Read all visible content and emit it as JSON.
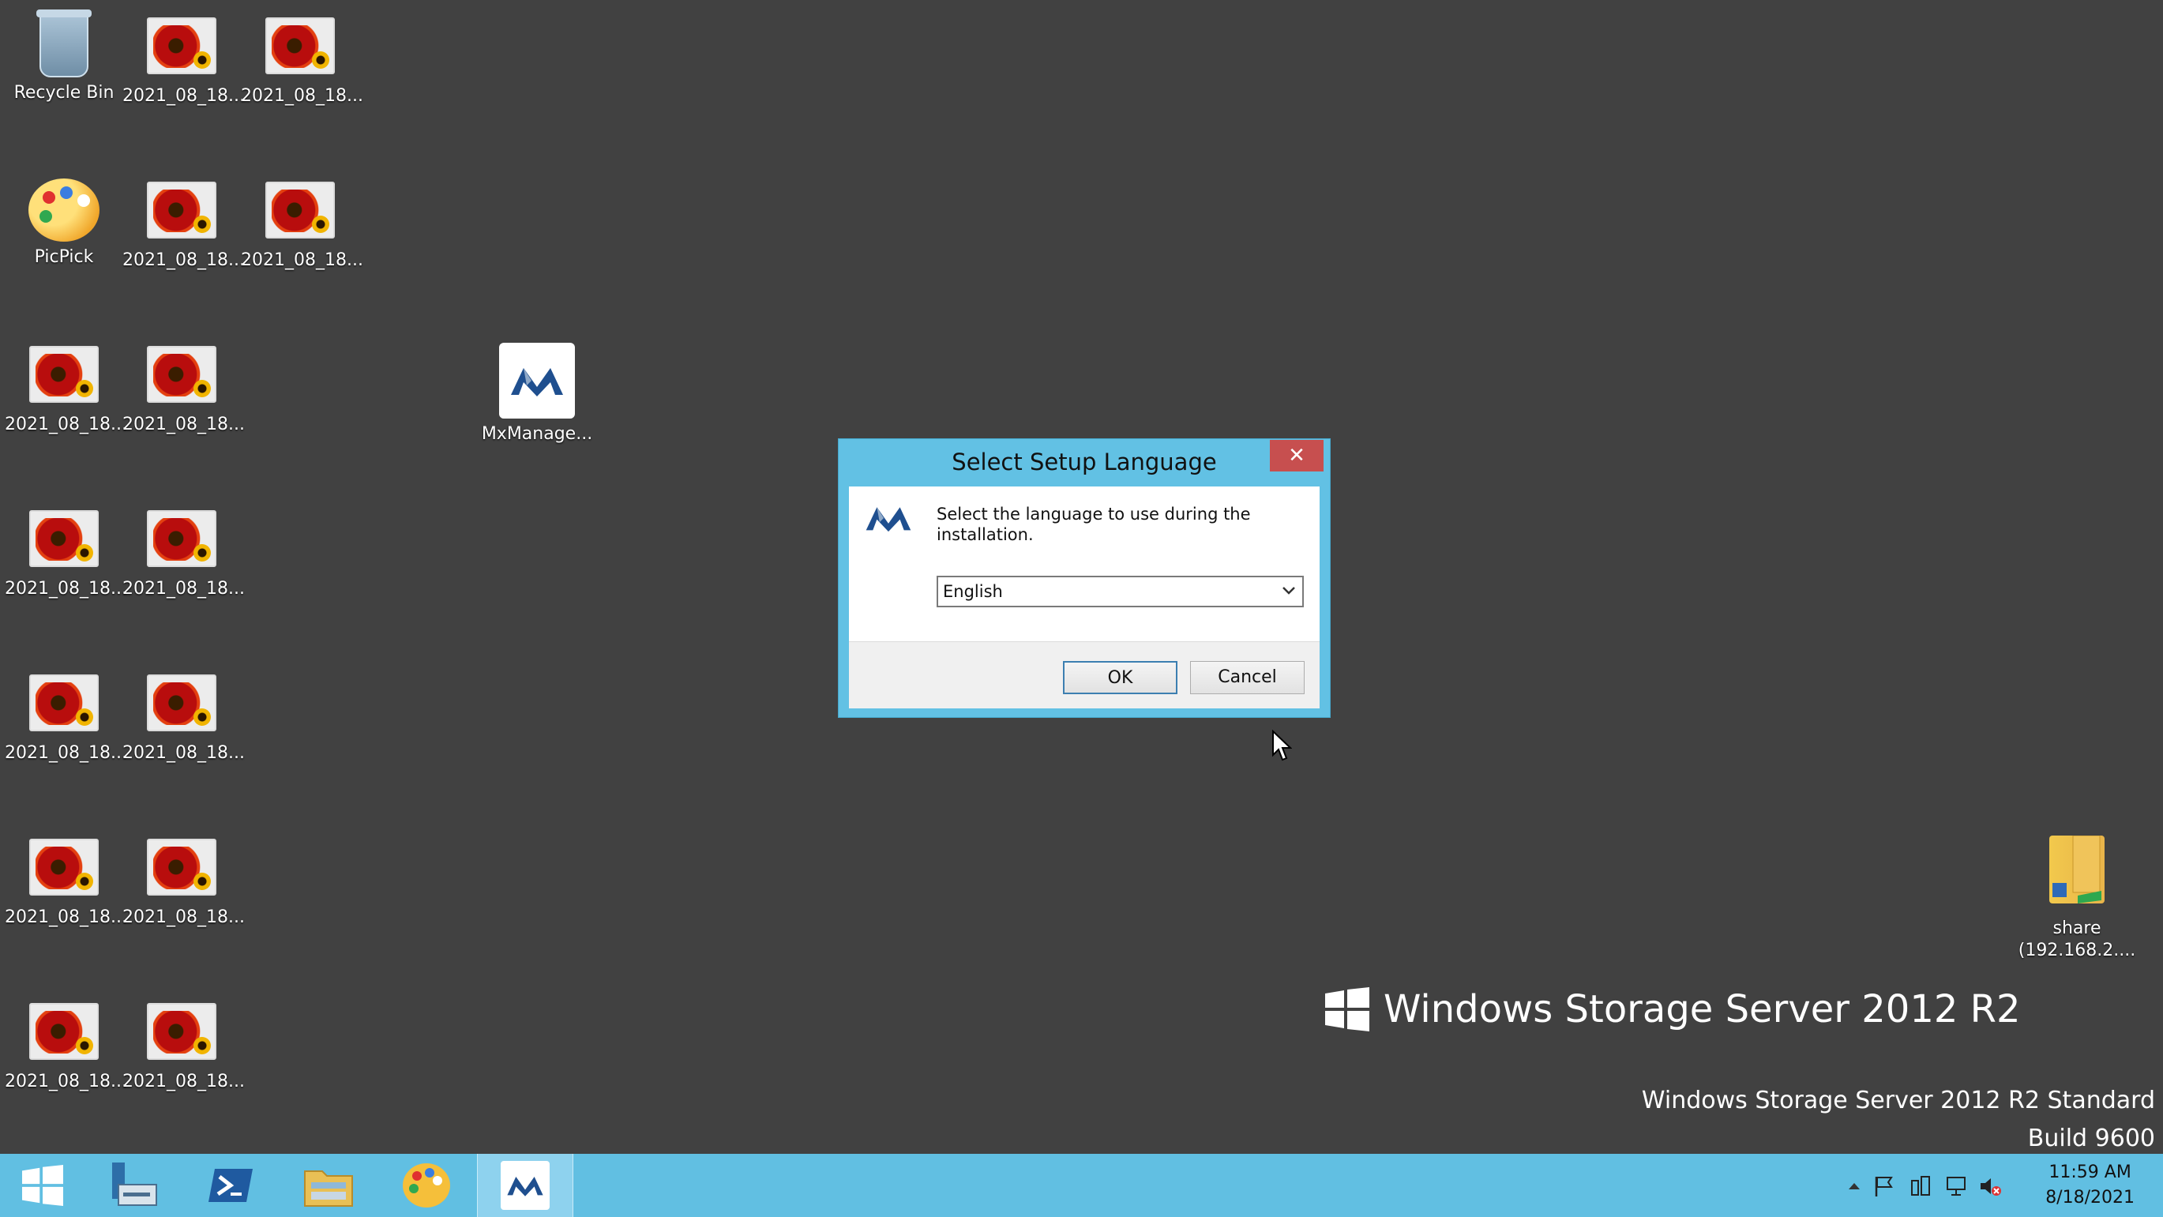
{
  "desktop": {
    "icons": [
      {
        "label": "Recycle Bin",
        "icon": "recycle-bin-icon"
      },
      {
        "label": "2021_08_18...",
        "icon": "image-file-icon"
      },
      {
        "label": "2021_08_18...",
        "icon": "image-file-icon"
      },
      {
        "label": "PicPick",
        "icon": "picpick-icon"
      },
      {
        "label": "2021_08_18...",
        "icon": "image-file-icon"
      },
      {
        "label": "2021_08_18...",
        "icon": "image-file-icon"
      },
      {
        "label": "2021_08_18...",
        "icon": "image-file-icon"
      },
      {
        "label": "2021_08_18...",
        "icon": "image-file-icon"
      },
      {
        "label": "MxManage...",
        "icon": "mxmanage-icon"
      },
      {
        "label": "2021_08_18...",
        "icon": "image-file-icon"
      },
      {
        "label": "2021_08_18...",
        "icon": "image-file-icon"
      },
      {
        "label": "2021_08_18...",
        "icon": "image-file-icon"
      },
      {
        "label": "2021_08_18...",
        "icon": "image-file-icon"
      },
      {
        "label": "2021_08_18...",
        "icon": "image-file-icon"
      },
      {
        "label": "2021_08_18...",
        "icon": "image-file-icon"
      },
      {
        "label": "2021_08_18...",
        "icon": "image-file-icon"
      },
      {
        "label": "2021_08_18...",
        "icon": "image-file-icon"
      },
      {
        "label": "share\n(192.168.2....",
        "icon": "network-share-folder-icon"
      }
    ],
    "watermark_logo_text": "Windows Storage Server 2012 R2",
    "edition_line": "Windows Storage Server 2012 R2 Standard",
    "build_line": "Build 9600"
  },
  "dialog": {
    "title": "Select Setup Language",
    "close_label": "✕",
    "prompt": "Select the language to use during the installation.",
    "language_selected": "English",
    "ok_label": "OK",
    "cancel_label": "Cancel"
  },
  "taskbar": {
    "apps": [
      {
        "name": "start-button",
        "icon": "windows-logo-icon"
      },
      {
        "name": "server-manager",
        "icon": "server-manager-icon"
      },
      {
        "name": "powershell",
        "icon": "powershell-icon"
      },
      {
        "name": "file-explorer",
        "icon": "folder-icon"
      },
      {
        "name": "picpick",
        "icon": "picpick-icon"
      },
      {
        "name": "mxmanage-setup",
        "icon": "mxmanage-icon"
      }
    ],
    "clock_time": "11:59 AM",
    "clock_date": "8/18/2021"
  },
  "colors": {
    "desktop_bg": "#414141",
    "taskbar_bg": "#61bfe2",
    "dialog_frame": "#62c1e4",
    "close_red": "#c74f4f"
  }
}
